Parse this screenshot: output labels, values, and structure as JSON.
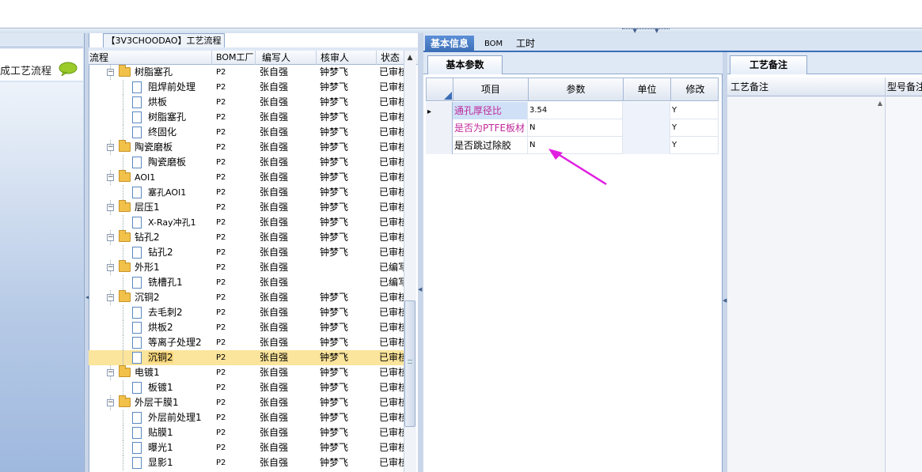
{
  "left_panel": {
    "title": "成工艺流程",
    "icon": "speech-bubble-icon"
  },
  "tree_panel": {
    "title": "【3V3CHOODAO】工艺流程",
    "columns": [
      "流程",
      "BOM工厂",
      "编写人",
      "核审人",
      "状态"
    ],
    "rows": [
      {
        "name": "树脂塞孔",
        "type": "folder",
        "level": 0,
        "bom": "P2",
        "author": "张自强",
        "reviewer": "钟梦飞",
        "status": "已审核"
      },
      {
        "name": "阻焊前处理",
        "type": "doc",
        "level": 1,
        "bom": "P2",
        "author": "张自强",
        "reviewer": "钟梦飞",
        "status": "已审核"
      },
      {
        "name": "烘板",
        "type": "doc",
        "level": 1,
        "bom": "P2",
        "author": "张自强",
        "reviewer": "钟梦飞",
        "status": "已审核"
      },
      {
        "name": "树脂塞孔",
        "type": "doc",
        "level": 1,
        "bom": "P2",
        "author": "张自强",
        "reviewer": "钟梦飞",
        "status": "已审核"
      },
      {
        "name": "终固化",
        "type": "doc",
        "level": 1,
        "bom": "P2",
        "author": "张自强",
        "reviewer": "钟梦飞",
        "status": "已审核"
      },
      {
        "name": "陶瓷磨板",
        "type": "folder",
        "level": 0,
        "bom": "P2",
        "author": "张自强",
        "reviewer": "钟梦飞",
        "status": "已审核"
      },
      {
        "name": "陶瓷磨板",
        "type": "doc",
        "level": 1,
        "bom": "P2",
        "author": "张自强",
        "reviewer": "钟梦飞",
        "status": "已审核"
      },
      {
        "name": "AOI1",
        "type": "folder",
        "level": 0,
        "bom": "P2",
        "author": "张自强",
        "reviewer": "钟梦飞",
        "status": "已审核"
      },
      {
        "name": "塞孔AOI1",
        "type": "doc",
        "level": 1,
        "bom": "P2",
        "author": "张自强",
        "reviewer": "钟梦飞",
        "status": "已审核"
      },
      {
        "name": "层压1",
        "type": "folder",
        "level": 0,
        "bom": "P2",
        "author": "张自强",
        "reviewer": "钟梦飞",
        "status": "已审核"
      },
      {
        "name": "X-Ray冲孔1",
        "type": "doc",
        "level": 1,
        "bom": "P2",
        "author": "张自强",
        "reviewer": "钟梦飞",
        "status": "已审核"
      },
      {
        "name": "钻孔2",
        "type": "folder",
        "level": 0,
        "bom": "P2",
        "author": "张自强",
        "reviewer": "钟梦飞",
        "status": "已审核"
      },
      {
        "name": "钻孔2",
        "type": "doc",
        "level": 1,
        "bom": "P2",
        "author": "张自强",
        "reviewer": "钟梦飞",
        "status": "已审核"
      },
      {
        "name": "外形1",
        "type": "folder",
        "level": 0,
        "bom": "P2",
        "author": "张自强",
        "reviewer": "",
        "status": "已编写"
      },
      {
        "name": "铣槽孔1",
        "type": "doc",
        "level": 1,
        "bom": "P2",
        "author": "张自强",
        "reviewer": "",
        "status": "已编写"
      },
      {
        "name": "沉铜2",
        "type": "folder",
        "level": 0,
        "bom": "P2",
        "author": "张自强",
        "reviewer": "钟梦飞",
        "status": "已审核"
      },
      {
        "name": "去毛刺2",
        "type": "doc",
        "level": 1,
        "bom": "P2",
        "author": "张自强",
        "reviewer": "钟梦飞",
        "status": "已审核"
      },
      {
        "name": "烘板2",
        "type": "doc",
        "level": 1,
        "bom": "P2",
        "author": "张自强",
        "reviewer": "钟梦飞",
        "status": "已审核"
      },
      {
        "name": "等离子处理2",
        "type": "doc",
        "level": 1,
        "bom": "P2",
        "author": "张自强",
        "reviewer": "钟梦飞",
        "status": "已审核"
      },
      {
        "name": "沉铜2",
        "type": "doc",
        "level": 1,
        "bom": "P2",
        "author": "张自强",
        "reviewer": "钟梦飞",
        "status": "已审核",
        "selected": true
      },
      {
        "name": "电镀1",
        "type": "folder",
        "level": 0,
        "bom": "P2",
        "author": "张自强",
        "reviewer": "钟梦飞",
        "status": "已审核"
      },
      {
        "name": "板镀1",
        "type": "doc",
        "level": 1,
        "bom": "P2",
        "author": "张自强",
        "reviewer": "钟梦飞",
        "status": "已审核"
      },
      {
        "name": "外层干膜1",
        "type": "folder",
        "level": 0,
        "bom": "P2",
        "author": "张自强",
        "reviewer": "钟梦飞",
        "status": "已审核"
      },
      {
        "name": "外层前处理1",
        "type": "doc",
        "level": 1,
        "bom": "P2",
        "author": "张自强",
        "reviewer": "钟梦飞",
        "status": "已审核"
      },
      {
        "name": "贴膜1",
        "type": "doc",
        "level": 1,
        "bom": "P2",
        "author": "张自强",
        "reviewer": "钟梦飞",
        "status": "已审核"
      },
      {
        "name": "曝光1",
        "type": "doc",
        "level": 1,
        "bom": "P2",
        "author": "张自强",
        "reviewer": "钟梦飞",
        "status": "已审核"
      },
      {
        "name": "显影1",
        "type": "doc",
        "level": 1,
        "bom": "P2",
        "author": "张自强",
        "reviewer": "钟梦飞",
        "status": "已审核"
      }
    ]
  },
  "right_tabs": [
    "基本信息",
    "BOM",
    "工时"
  ],
  "basic_params": {
    "tab": "基本参数",
    "columns": [
      "项目",
      "参数",
      "单位",
      "修改"
    ],
    "rows": [
      {
        "item": "通孔厚径比",
        "param": "3.54",
        "unit": "",
        "modify": "Y",
        "current": true,
        "item_color": "#c0289a"
      },
      {
        "item": "是否为PTFE板材",
        "param": "N",
        "unit": "",
        "modify": "Y",
        "item_color": "#c0289a"
      },
      {
        "item": "是否跳过除胶",
        "param": "N",
        "unit": "",
        "modify": "Y",
        "item_color": "#000000"
      }
    ]
  },
  "notes": {
    "tab": "工艺备注",
    "columns": [
      "工艺备注",
      "型号备注"
    ]
  },
  "colors": {
    "accent": "#3b6eb6",
    "selection": "#fbe49b",
    "annotation_arrow": "#e020e0"
  }
}
